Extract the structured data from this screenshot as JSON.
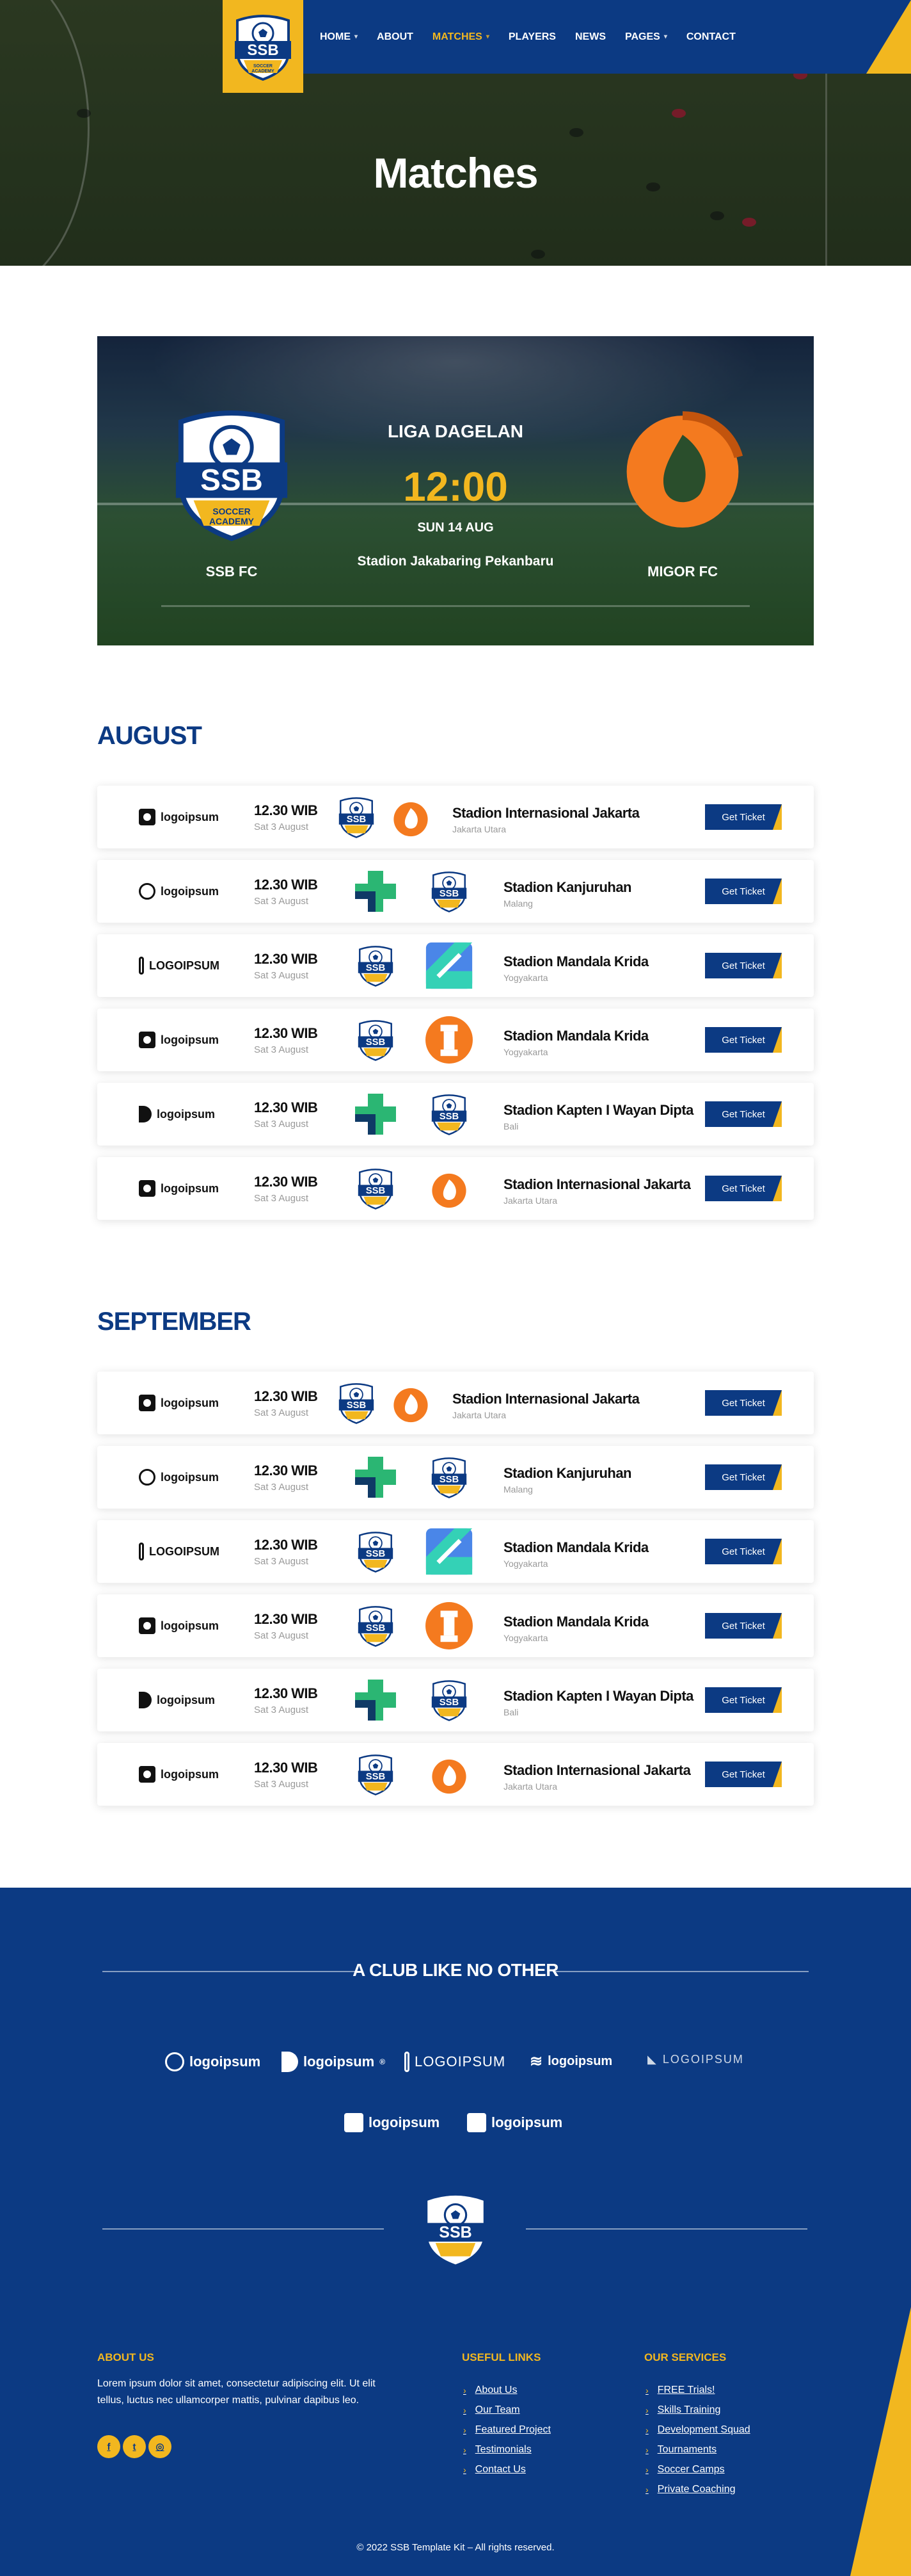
{
  "nav": {
    "items": [
      {
        "label": "HOME",
        "caret": true
      },
      {
        "label": "ABOUT",
        "caret": false
      },
      {
        "label": "MATCHES",
        "caret": true
      },
      {
        "label": "PLAYERS",
        "caret": false
      },
      {
        "label": "NEWS",
        "caret": false
      },
      {
        "label": "PAGES",
        "caret": true
      },
      {
        "label": "CONTACT",
        "caret": false
      }
    ],
    "active": "MATCHES",
    "logo": {
      "top": "SSB",
      "sub": "SOCCER ACADEMY"
    }
  },
  "hero": {
    "title": "Matches"
  },
  "featured": {
    "league": "LIGA DAGELAN",
    "time": "12:00",
    "date": "SUN 14 AUG",
    "venue": "Stadion Jakabaring Pekanbaru",
    "home": "SSB FC",
    "away": "MIGOR FC"
  },
  "sections": [
    {
      "title": "AUGUST"
    },
    {
      "title": "SEPTEMBER"
    }
  ],
  "matches": [
    {
      "sponsor": "logoipsum",
      "sponsor_icon": "square-logo-icon",
      "time": "12.30 WIB",
      "date": "Sat 3 August",
      "home": "ssb",
      "away": "orange-drop",
      "venue": "Stadion Internasional Jakarta",
      "city": "Jakarta Utara",
      "button": "Get Ticket"
    },
    {
      "sponsor": "logoipsum",
      "sponsor_icon": "circle-slash-logo-icon",
      "time": "12.30 WIB",
      "date": "Sat 3 August",
      "home": "green-cross",
      "away": "ssb",
      "venue": "Stadion Kanjuruhan",
      "city": "Malang",
      "button": "Get Ticket"
    },
    {
      "sponsor": "LOGOIPSUM",
      "sponsor_icon": "bar-logo-icon",
      "time": "12.30 WIB",
      "date": "Sat 3 August",
      "home": "ssb",
      "away": "blue-flag",
      "venue": "Stadion Mandala Krida",
      "city": "Yogyakarta",
      "button": "Get Ticket"
    },
    {
      "sponsor": "logoipsum",
      "sponsor_icon": "square-logo-icon",
      "time": "12.30 WIB",
      "date": "Sat 3 August",
      "home": "ssb",
      "away": "orange-pillar",
      "venue": "Stadion Mandala Krida",
      "city": "Yogyakarta",
      "button": "Get Ticket"
    },
    {
      "sponsor": "logoipsum",
      "sponsor_icon": "d-logo-icon",
      "time": "12.30 WIB",
      "date": "Sat 3 August",
      "home": "green-cross",
      "away": "ssb",
      "venue": "Stadion Kapten I Wayan Dipta",
      "city": "Bali",
      "button": "Get Ticket"
    },
    {
      "sponsor": "logoipsum",
      "sponsor_icon": "square-logo-icon",
      "time": "12.30 WIB",
      "date": "Sat 3 August",
      "home": "ssb",
      "away": "orange-drop",
      "venue": "Stadion Internasional Jakarta",
      "city": "Jakarta Utara",
      "button": "Get Ticket"
    }
  ],
  "footer": {
    "club_title": "A CLUB LIKE NO OTHER",
    "logos": [
      "logoipsum",
      "logoipsum",
      "LOGOIPSUM",
      "logoipsum",
      "LOGOIPSUM",
      "logoipsum",
      "logoipsum"
    ],
    "about_title": "ABOUT US",
    "about_text": "Lorem ipsum dolor sit amet, consectetur adipiscing elit. Ut elit tellus, luctus nec ullamcorper mattis, pulvinar dapibus leo.",
    "links_title": "USEFUL LINKS",
    "links": [
      "About Us",
      "Our Team",
      "Featured Project",
      "Testimonials",
      "Contact Us"
    ],
    "services_title": "OUR SERVICES",
    "services": [
      "FREE Trials!",
      "Skills Training",
      "Development Squad",
      "Tournaments",
      "Soccer Camps",
      "Private Coaching"
    ],
    "social": [
      "facebook-icon",
      "twitter-icon",
      "instagram-icon"
    ],
    "copyright": "© 2022 SSB Template Kit – All rights reserved."
  },
  "colors": {
    "brand_blue": "#0c3a83",
    "brand_yellow": "#f2b71f",
    "orange": "#f47a1f",
    "green": "#2bb673"
  }
}
